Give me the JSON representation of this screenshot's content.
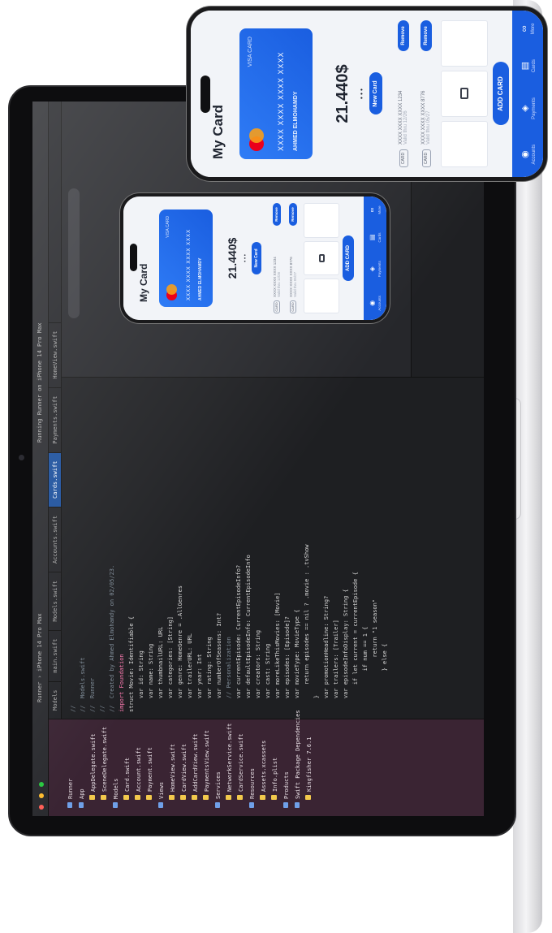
{
  "app": {
    "title": "My Card",
    "card": {
      "number": "XXXX  XXXX  XXXX  XXXX",
      "holder": "AHMED ELMOHAMDY",
      "label": "VISA  CARD"
    },
    "balance": "21.440$",
    "page_dots": "• • •",
    "new_card_label": "New Card",
    "saved_cards": [
      {
        "tag": "CARD",
        "number": "XXXX  XXXX  XXXX  1234",
        "sub": "Valid thru 12/26",
        "action": "Remove"
      },
      {
        "tag": "CARD",
        "number": "XXXX  XXXX  XXXX  8776",
        "sub": "Valid thru 05/27",
        "action": "Remove"
      }
    ],
    "add_card_label": "ADD CARD",
    "tabs": [
      {
        "icon": "◉",
        "label": "Accounts"
      },
      {
        "icon": "◈",
        "label": "Payments"
      },
      {
        "icon": "▤",
        "label": "Cards"
      },
      {
        "icon": "∞",
        "label": "More"
      }
    ]
  },
  "ide": {
    "scheme": "Runner  ›  iPhone 14 Pro Max",
    "status": "Running Runner on iPhone 14 Pro Max",
    "tabs": [
      "Models",
      "main.swift",
      "Models.swift",
      "Accounts.swift",
      "Cards.swift",
      "Payments.swift",
      "HomeView.swift"
    ],
    "navigator": [
      {
        "kind": "folder",
        "label": "Runner"
      },
      {
        "kind": "folder",
        "label": "App"
      },
      {
        "kind": "file",
        "label": "AppDelegate.swift"
      },
      {
        "kind": "file",
        "label": "SceneDelegate.swift"
      },
      {
        "kind": "folder",
        "label": "Models"
      },
      {
        "kind": "file",
        "label": "Card.swift"
      },
      {
        "kind": "file",
        "label": "Account.swift"
      },
      {
        "kind": "file",
        "label": "Payment.swift"
      },
      {
        "kind": "folder",
        "label": "Views"
      },
      {
        "kind": "file",
        "label": "HomeView.swift"
      },
      {
        "kind": "file",
        "label": "CardView.swift"
      },
      {
        "kind": "file",
        "label": "AddCardView.swift"
      },
      {
        "kind": "file",
        "label": "PaymentsView.swift"
      },
      {
        "kind": "folder",
        "label": "Services"
      },
      {
        "kind": "file",
        "label": "NetworkService.swift"
      },
      {
        "kind": "file",
        "label": "CardService.swift"
      },
      {
        "kind": "folder",
        "label": "Resources"
      },
      {
        "kind": "file",
        "label": "Assets.xcassets"
      },
      {
        "kind": "file",
        "label": "Info.plist"
      },
      {
        "kind": "folder",
        "label": "Products"
      },
      {
        "kind": "folder",
        "label": "Swift Package Dependencies"
      },
      {
        "kind": "file",
        "label": "Kingfisher 7.6.1"
      }
    ],
    "code": [
      {
        "cls": "cm",
        "text": "//"
      },
      {
        "cls": "cm",
        "text": "//  Models.swift"
      },
      {
        "cls": "cm",
        "text": "//  Runner"
      },
      {
        "cls": "cm",
        "text": "//"
      },
      {
        "cls": "cm",
        "text": "//  Created by Ahmed Elmohamdy on 02/05/23."
      },
      {
        "cls": "",
        "text": ""
      },
      {
        "cls": "kw",
        "text": "import Foundation"
      },
      {
        "cls": "",
        "text": ""
      },
      {
        "cls": "",
        "text": "struct Movie: Identifiable {"
      },
      {
        "cls": "",
        "text": "    var id: String"
      },
      {
        "cls": "",
        "text": "    var name: String"
      },
      {
        "cls": "",
        "text": "    var thumbnailURL: URL"
      },
      {
        "cls": "",
        "text": "    var categories: [String]"
      },
      {
        "cls": "",
        "text": "    var genre: HomeGenre = .AllGenres"
      },
      {
        "cls": "",
        "text": ""
      },
      {
        "cls": "",
        "text": "    var trailerURL: URL"
      },
      {
        "cls": "",
        "text": "    var year: Int"
      },
      {
        "cls": "",
        "text": "    var rating: String"
      },
      {
        "cls": "",
        "text": "    var numberOfSeasons: Int?"
      },
      {
        "cls": "",
        "text": ""
      },
      {
        "cls": "cm",
        "text": "    // Personalization"
      },
      {
        "cls": "",
        "text": "    var currentEpisode: CurrentEpisodeInfo?"
      },
      {
        "cls": "",
        "text": "    var defaultEpisodeInfo: CurrentEpisodeInfo"
      },
      {
        "cls": "",
        "text": "    var creators: String"
      },
      {
        "cls": "",
        "text": "    var cast: String"
      },
      {
        "cls": "",
        "text": ""
      },
      {
        "cls": "",
        "text": "    var moreLikeThisMovies: [Movie]"
      },
      {
        "cls": "",
        "text": ""
      },
      {
        "cls": "",
        "text": "    var episodes: [Episode]?"
      },
      {
        "cls": "",
        "text": ""
      },
      {
        "cls": "",
        "text": "    var movieType: MovieType {"
      },
      {
        "cls": "",
        "text": "        return episodes == nil ? .movie : .tvShow"
      },
      {
        "cls": "",
        "text": "    }"
      },
      {
        "cls": "",
        "text": ""
      },
      {
        "cls": "",
        "text": "    var promotionHeadline: String?"
      },
      {
        "cls": "",
        "text": ""
      },
      {
        "cls": "",
        "text": "    var trailers: [Trailer]"
      },
      {
        "cls": "",
        "text": ""
      },
      {
        "cls": "",
        "text": "    var episodeInfoDisplay: String {"
      },
      {
        "cls": "",
        "text": "        if let current = currentEpisode {"
      },
      {
        "cls": "",
        "text": "            if num == 1 {"
      },
      {
        "cls": "",
        "text": "                return \"1 season\""
      },
      {
        "cls": "",
        "text": "            } else {"
      }
    ]
  },
  "colors": {
    "brand": "#1a5ee0",
    "nav_bg": "#3a2433",
    "editor_bg": "#1e1f22"
  }
}
